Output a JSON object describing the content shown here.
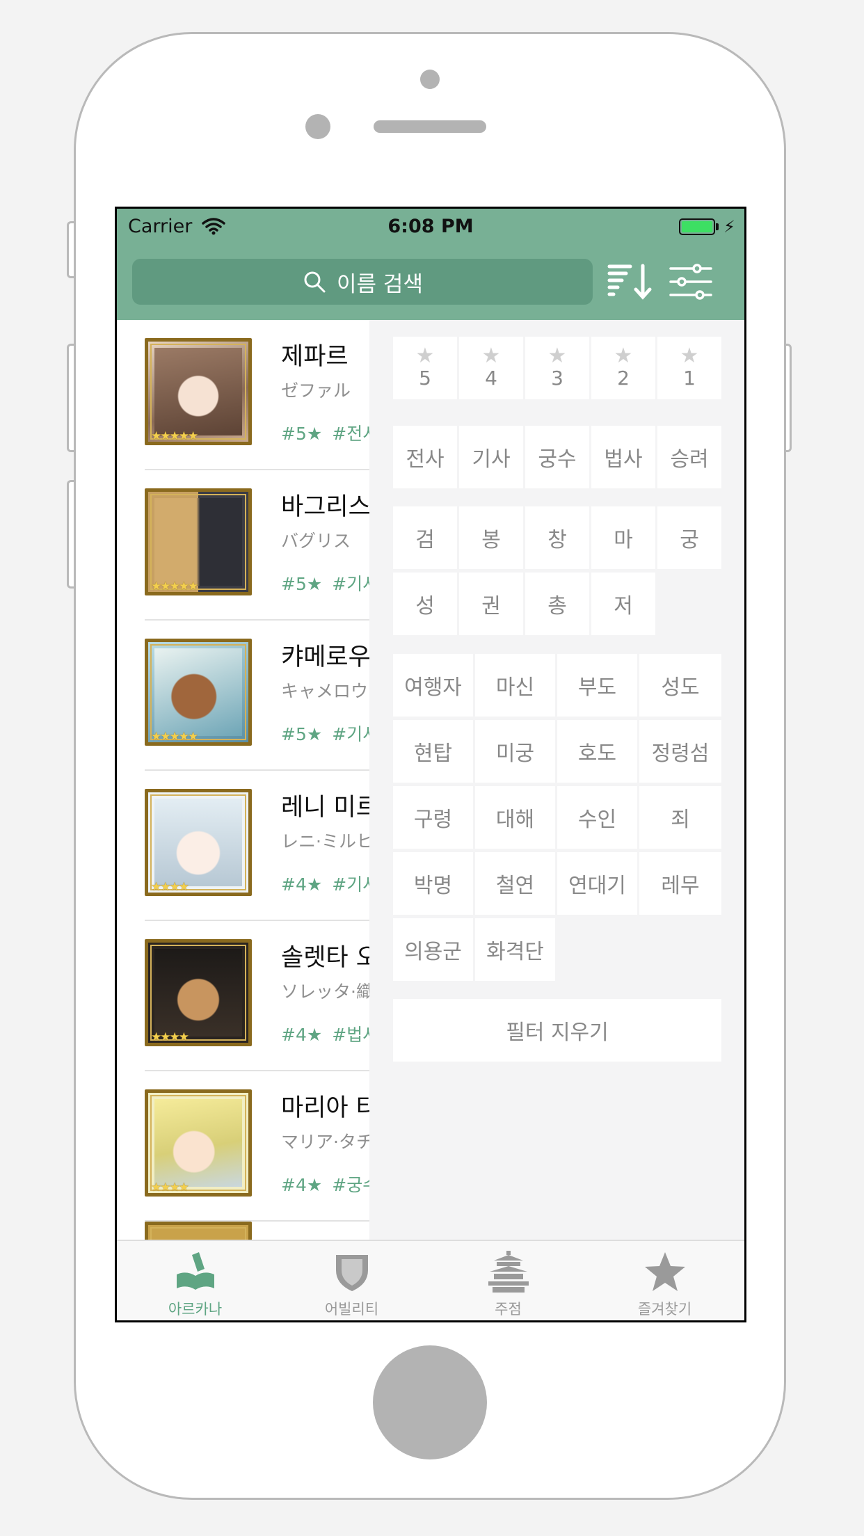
{
  "status_bar": {
    "carrier": "Carrier",
    "time": "6:08 PM"
  },
  "navbar": {
    "search_placeholder": "이름 검색",
    "sort_icon": "sort-descending-icon",
    "filter_icon": "sliders-icon"
  },
  "list": {
    "items": [
      {
        "name": "제파르",
        "jp": "ゼファル",
        "rarity": "#5★",
        "tag": "#전시",
        "stars": "★★★★★"
      },
      {
        "name": "바그리스",
        "jp": "バグリス",
        "rarity": "#5★",
        "tag": "#기사",
        "stars": "★★★★★"
      },
      {
        "name": "캬메로우",
        "jp": "キャメロウ",
        "rarity": "#5★",
        "tag": "#기사",
        "stars": "★★★★★"
      },
      {
        "name": "레니 미르",
        "jp": "レニ·ミルヒ",
        "rarity": "#4★",
        "tag": "#기사",
        "stars": "★★★★"
      },
      {
        "name": "솔렛타 오",
        "jp": "ソレッタ·織",
        "rarity": "#4★",
        "tag": "#법사",
        "stars": "★★★★"
      },
      {
        "name": "마리아 타",
        "jp": "マリア·タチ",
        "rarity": "#4★",
        "tag": "#궁수",
        "stars": "★★★★"
      }
    ]
  },
  "filter": {
    "rarity": [
      "5",
      "4",
      "3",
      "2",
      "1"
    ],
    "classes": [
      "전사",
      "기사",
      "궁수",
      "법사",
      "승려"
    ],
    "weapons": [
      "검",
      "봉",
      "창",
      "마",
      "궁",
      "성",
      "권",
      "총",
      "저"
    ],
    "affiliations": [
      "여행자",
      "마신",
      "부도",
      "성도",
      "현탑",
      "미궁",
      "호도",
      "정령섬",
      "구령",
      "대해",
      "수인",
      "죄",
      "박명",
      "철연",
      "연대기",
      "레무",
      "의용군",
      "화격단"
    ],
    "clear_label": "필터 지우기"
  },
  "tabbar": {
    "tabs": [
      {
        "label": "아르카나",
        "icon": "book-icon",
        "active": true
      },
      {
        "label": "어빌리티",
        "icon": "shield-icon",
        "active": false
      },
      {
        "label": "주점",
        "icon": "pagoda-icon",
        "active": false
      },
      {
        "label": "즐겨찾기",
        "icon": "star-icon",
        "active": false
      }
    ]
  },
  "colors": {
    "accent": "#78b095",
    "accent_dark": "#609a80",
    "tag_green": "#5fa583",
    "panel_bg": "#f4f4f5"
  }
}
